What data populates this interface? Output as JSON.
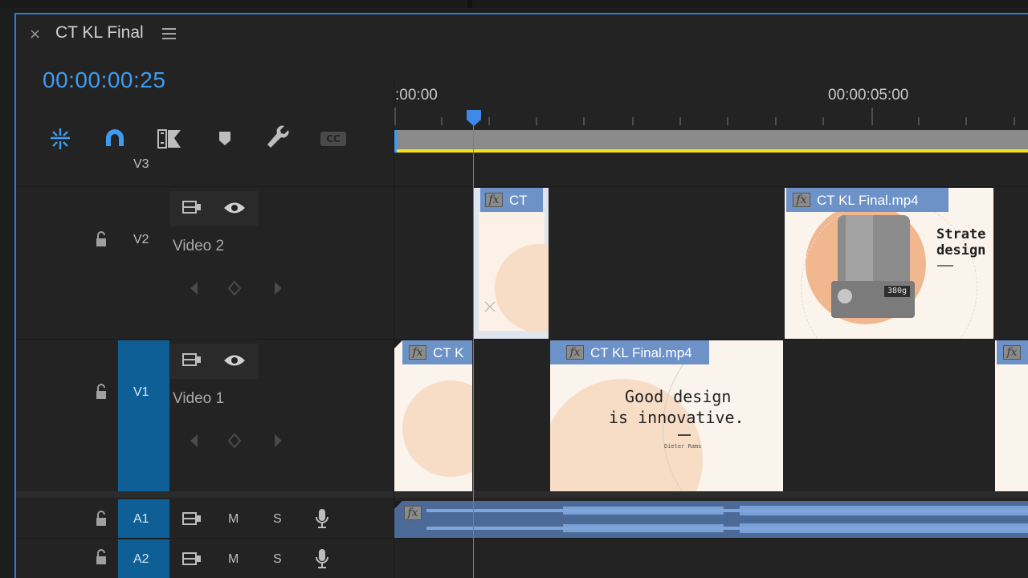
{
  "panel": {
    "close_glyph": "×",
    "sequence_title": "CT KL Final",
    "timecode": "00:00:00:25"
  },
  "toolbar": {
    "tools": [
      {
        "name": "insert-overwrite-nest-icon",
        "active": true
      },
      {
        "name": "snap-magnet-icon",
        "active": true
      },
      {
        "name": "linked-selection-icon",
        "active": false
      },
      {
        "name": "add-marker-icon",
        "active": false
      },
      {
        "name": "timeline-settings-wrench-icon",
        "active": false
      },
      {
        "name": "captions-cc-icon",
        "active": false,
        "label": "CC"
      }
    ]
  },
  "ruler": {
    "start_label": ":00:00",
    "mid_label": "00:00:05:00"
  },
  "tracks": {
    "v3": {
      "label": "V3"
    },
    "v2": {
      "label": "V2",
      "name": "Video 2"
    },
    "v1": {
      "label": "V1",
      "name": "Video 1"
    },
    "a1": {
      "label": "A1",
      "mute": "M",
      "solo": "S"
    },
    "a2": {
      "label": "A2",
      "mute": "M",
      "solo": "S"
    }
  },
  "clips": {
    "v2_small": {
      "label": "CT",
      "fx": "fx"
    },
    "v2_large": {
      "label": "CT KL Final.mp4",
      "fx": "fx",
      "text_line1": "Strate",
      "text_line2": "design",
      "weight": "380g"
    },
    "v1_first": {
      "label": "CT K",
      "fx": "fx"
    },
    "v1_main": {
      "label": "CT KL Final.mp4",
      "fx": "fx",
      "text_line1": "Good design",
      "text_line2": "is innovative.",
      "credit": "Dieter Rams"
    },
    "v1_last": {
      "fx": "fx"
    },
    "a1_audio": {
      "fx": "fx"
    }
  },
  "colors": {
    "accent_blue": "#3e9cf0",
    "target_track": "#0e5f96",
    "clip_header": "#6d92c8",
    "work_area_bar": "#f4e21a",
    "audio_clip": "#4c6a97"
  }
}
